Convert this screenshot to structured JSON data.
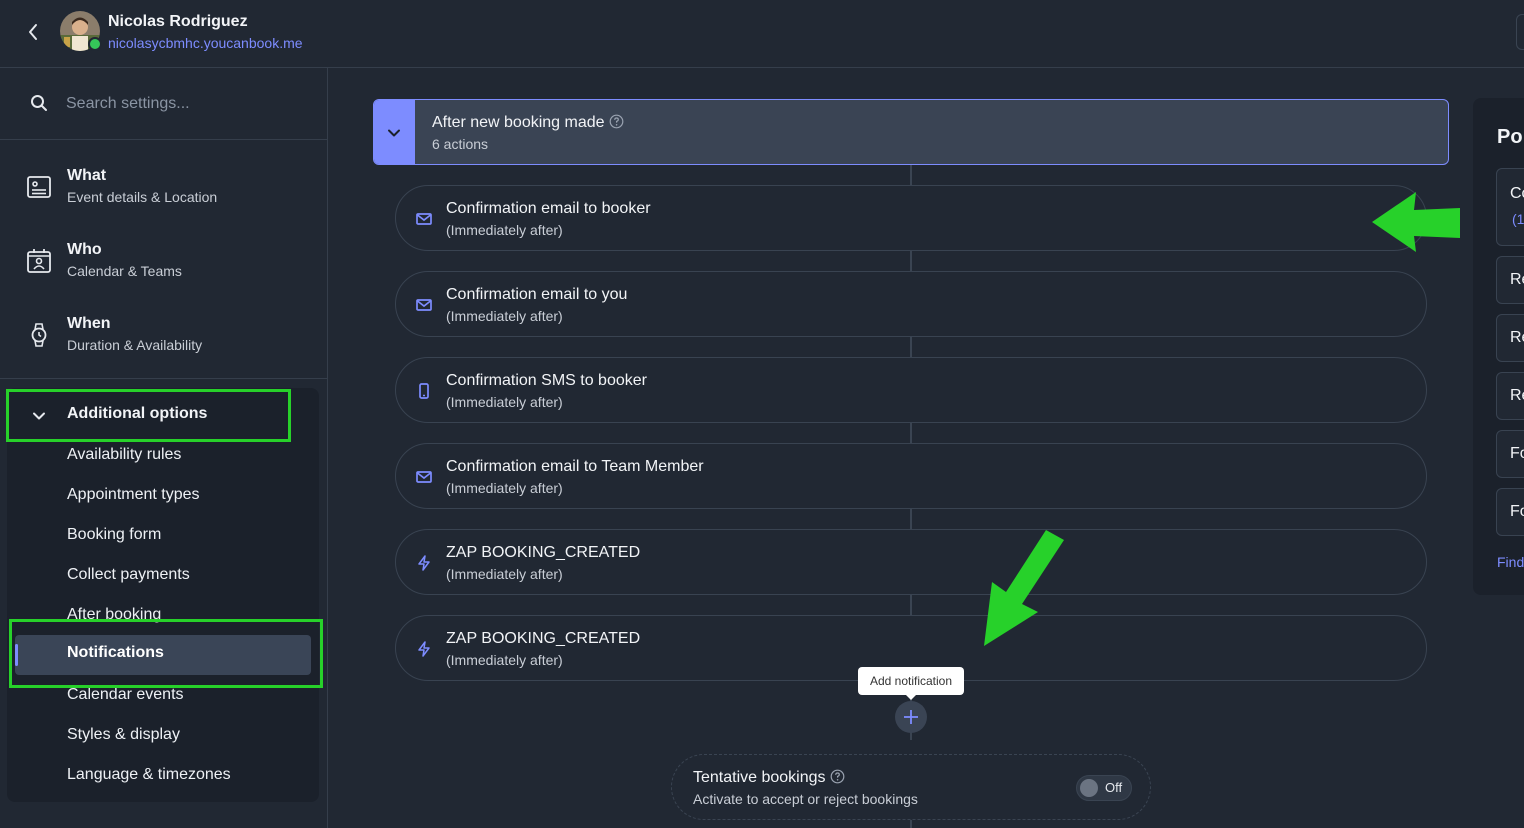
{
  "header": {
    "user_name": "Nicolas Rodriguez",
    "user_url": "nicolasycbmhc.youcanbook.me"
  },
  "sidebar": {
    "search_placeholder": "Search settings...",
    "nav": [
      {
        "title": "What",
        "subtitle": "Event details & Location"
      },
      {
        "title": "Who",
        "subtitle": "Calendar & Teams"
      },
      {
        "title": "When",
        "subtitle": "Duration & Availability"
      }
    ],
    "additional": {
      "title": "Additional options",
      "items": [
        "Availability rules",
        "Appointment types",
        "Booking form",
        "Collect payments",
        "After booking",
        "Notifications",
        "Calendar events",
        "Styles & display",
        "Language & timezones"
      ],
      "active_index": 5
    }
  },
  "main": {
    "group": {
      "title": "After new booking made",
      "count": "6 actions"
    },
    "actions": [
      {
        "title": "Confirmation email to booker",
        "subtitle": "(Immediately after)",
        "icon": "mail-icon"
      },
      {
        "title": "Confirmation email to you",
        "subtitle": "(Immediately after)",
        "icon": "mail-icon"
      },
      {
        "title": "Confirmation SMS to booker",
        "subtitle": "(Immediately after)",
        "icon": "phone-icon"
      },
      {
        "title": "Confirmation email to Team Member",
        "subtitle": "(Immediately after)",
        "icon": "mail-icon"
      },
      {
        "title": "ZAP BOOKING_CREATED",
        "subtitle": "(Immediately after)",
        "icon": "zap-icon"
      },
      {
        "title": "ZAP BOOKING_CREATED",
        "subtitle": "(Immediately after)",
        "icon": "zap-icon"
      }
    ],
    "tooltip": "Add notification",
    "tentative": {
      "title": "Tentative bookings",
      "subtitle": "Activate to accept or reject bookings",
      "toggle_label": "Off"
    }
  },
  "right_panel": {
    "title": "Po",
    "cards": [
      {
        "label": "Co",
        "sub": "(1"
      },
      {
        "label": "Re"
      },
      {
        "label": "Re"
      },
      {
        "label": "Re"
      },
      {
        "label": "Fo"
      },
      {
        "label": "Fo"
      }
    ],
    "link": "Find"
  },
  "colors": {
    "background": "#212833",
    "accent": "#7d8cff",
    "highlight": "#27d12a"
  }
}
